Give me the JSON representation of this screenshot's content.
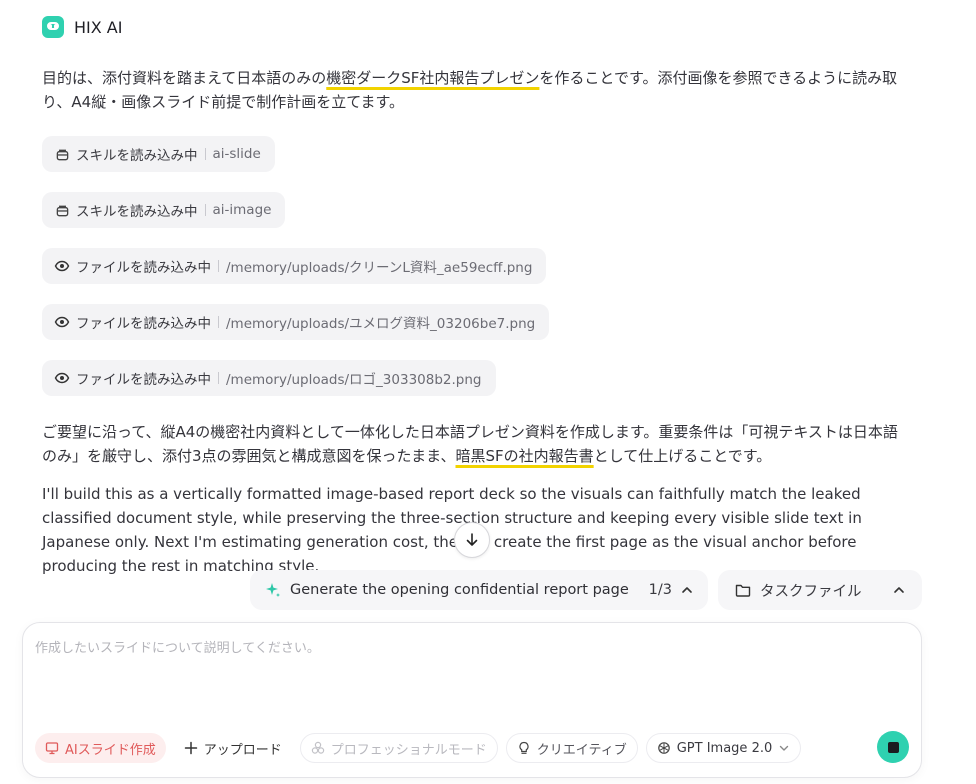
{
  "app": {
    "title": "HIX AI"
  },
  "intro": {
    "part1": "目的は、添付資料を踏まえて日本語のみの",
    "highlight": "機密ダークSF社内報告プレゼン",
    "part2": "を作ることです。添付画像を参照できるように読み取り、A4縦・画像スライド前提で制作計画を立てます。"
  },
  "chips": [
    {
      "icon": "skill",
      "label": "スキルを読み込み中",
      "sub": "ai-slide"
    },
    {
      "icon": "skill",
      "label": "スキルを読み込み中",
      "sub": "ai-image"
    },
    {
      "icon": "eye",
      "label": "ファイルを読み込み中",
      "sub": "/memory/uploads/クリーンL資料_ae59ecff.png"
    },
    {
      "icon": "eye",
      "label": "ファイルを読み込み中",
      "sub": "/memory/uploads/ユメログ資料_03206be7.png"
    },
    {
      "icon": "eye",
      "label": "ファイルを読み込み中",
      "sub": "/memory/uploads/ロゴ_303308b2.png"
    }
  ],
  "response": {
    "part1": "ご要望に沿って、縦A4の機密社内資料として一体化した日本語プレゼン資料を作成します。重要条件は「可視テキストは日本語のみ」を厳守し、添付3点の雰囲気と構成意図を保ったまま、",
    "highlight": "暗黒SFの社内報告書",
    "part2": "として仕上げることです。"
  },
  "english": {
    "text": "I'll build this as a vertically formatted image-based report deck so the visuals can faithfully match the leaked classified document style, while preserving the three-section structure and keeping every visible slide text in Japanese only. Next I'm estimating generation cost, then I'll create the first page as the visual anchor before producing the rest in matching style."
  },
  "task": {
    "label": "Generate the opening confidential report page",
    "count": "1/3"
  },
  "task_file": {
    "label": "タスクファイル"
  },
  "composer": {
    "placeholder": "作成したいスライドについて説明してください。",
    "slide_label": "AIスライド作成",
    "upload_label": "アップロード",
    "pro_label": "プロフェッショナルモード",
    "creative_label": "クリエイティブ",
    "model_label": "GPT Image 2.0"
  }
}
